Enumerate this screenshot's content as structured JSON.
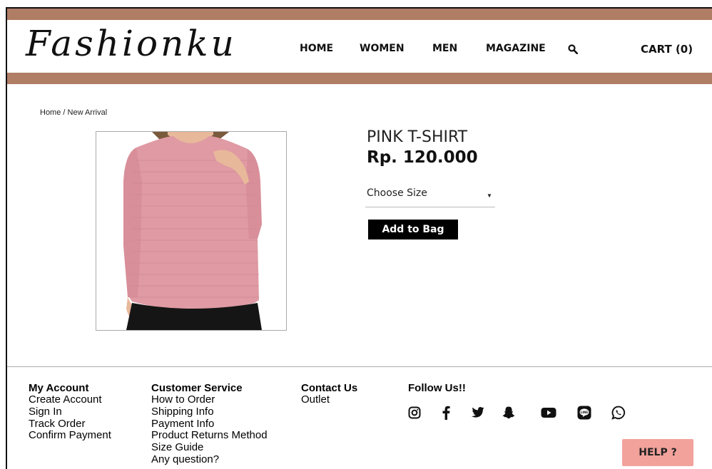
{
  "brand": {
    "logo": "Fashionku"
  },
  "nav": {
    "items": [
      {
        "label": "HOME"
      },
      {
        "label": "WOMEN"
      },
      {
        "label": "MEN"
      },
      {
        "label": "MAGAZINE"
      }
    ],
    "search_icon": "search-icon",
    "cart_label": "CART (0)"
  },
  "breadcrumb": "Home / New Arrival",
  "product": {
    "name": "PINK T-SHIRT",
    "price": "Rp. 120.000",
    "size_placeholder": "Choose Size",
    "add_to_bag_label": "Add to Bag"
  },
  "footer": {
    "my_account": {
      "title": "My Account",
      "links": [
        "Create Account",
        "Sign In",
        "Track Order",
        "Confirm Payment"
      ]
    },
    "customer_service": {
      "title": "Customer Service",
      "links": [
        "How to Order",
        "Shipping Info",
        "Payment Info",
        "Product Returns Method",
        "Size Guide",
        "Any question?"
      ]
    },
    "contact_us": {
      "title": "Contact Us",
      "links": [
        "Outlet"
      ]
    },
    "follow_us": {
      "title": "Follow Us!!",
      "icons": [
        "instagram-icon",
        "facebook-icon",
        "twitter-icon",
        "snapchat-icon",
        "youtube-icon",
        "line-icon",
        "whatsapp-icon"
      ]
    }
  },
  "help_label": "HELP ?",
  "colors": {
    "band": "#b07d65",
    "help": "#f2a29b",
    "shirt": "#df9aa3"
  }
}
